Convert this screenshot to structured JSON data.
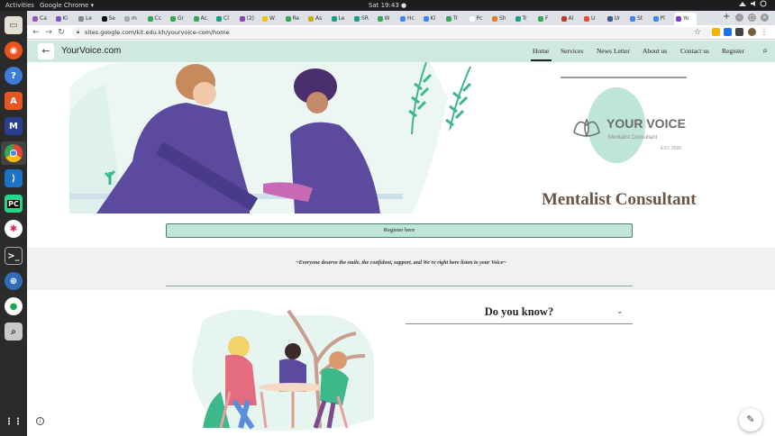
{
  "system_bar": {
    "activities": "Activities",
    "app_menu": "Google Chrome ▾",
    "clock": "Sat 19:43 ●",
    "tray_icons": [
      "network-icon",
      "volume-icon",
      "power-icon"
    ]
  },
  "browser": {
    "tabs": [
      {
        "label": "Ca",
        "color": "#9b59b6"
      },
      {
        "label": "Ki",
        "color": "#7e57c2"
      },
      {
        "label": "Le",
        "color": "#888888"
      },
      {
        "label": "Se",
        "color": "#111111"
      },
      {
        "label": "m",
        "color": "#aaaaaa"
      },
      {
        "label": "Cc",
        "color": "#34a853"
      },
      {
        "label": "Gr",
        "color": "#34a853"
      },
      {
        "label": "Ac",
        "color": "#34a853"
      },
      {
        "label": "Cl",
        "color": "#16a085"
      },
      {
        "label": "(2)",
        "color": "#8e44ad"
      },
      {
        "label": "W",
        "color": "#f1c40f"
      },
      {
        "label": "Re",
        "color": "#34a853"
      },
      {
        "label": "As",
        "color": "#c0b000"
      },
      {
        "label": "Le",
        "color": "#16a085"
      },
      {
        "label": "SR",
        "color": "#16a085"
      },
      {
        "label": "W",
        "color": "#34a853"
      },
      {
        "label": "Hc",
        "color": "#4285f4"
      },
      {
        "label": "Kl",
        "color": "#4285f4"
      },
      {
        "label": "Tr",
        "color": "#34a853"
      },
      {
        "label": "Pc",
        "color": "#ffffff"
      },
      {
        "label": "Sh",
        "color": "#e67e22"
      },
      {
        "label": "Tr",
        "color": "#16a085"
      },
      {
        "label": "F",
        "color": "#34a853"
      },
      {
        "label": "Al",
        "color": "#c0392b"
      },
      {
        "label": "U",
        "color": "#e74c3c"
      },
      {
        "label": "Ur",
        "color": "#3b5998"
      },
      {
        "label": "St",
        "color": "#4285f4"
      },
      {
        "label": "Pl",
        "color": "#4285f4"
      },
      {
        "label": "Yo",
        "color": "#7b3fc4"
      }
    ],
    "new_tab_label": "+",
    "url": "sites.google.com/kit.edu.kh/yourvoice-com/home",
    "url_domain": "sites.google.com",
    "window_controls": {
      "minimize": "–",
      "maximize": "□",
      "close": "×"
    }
  },
  "site": {
    "title": "YourVoice.com",
    "nav": [
      "Home",
      "Services",
      "News Letter",
      "About us",
      "Contact us",
      "Register"
    ],
    "active_nav": "Home",
    "hero": {
      "logo_text": "YOUR VOICE",
      "logo_sub": "Mentalist Consultant",
      "logo_est": "EST. 2020",
      "headline": "Mentalist Consultant"
    },
    "register_button": "Register here",
    "quote": "~Everyone deserve the smile, the confident, support, and We're right here listen to your Voice~",
    "do_you_know": "Do you know?"
  },
  "colors": {
    "nav_bg": "#cfe9e1",
    "register_bg": "#bfe4da",
    "accent_purple": "#5b4a9e",
    "accent_green": "#3db88b"
  }
}
